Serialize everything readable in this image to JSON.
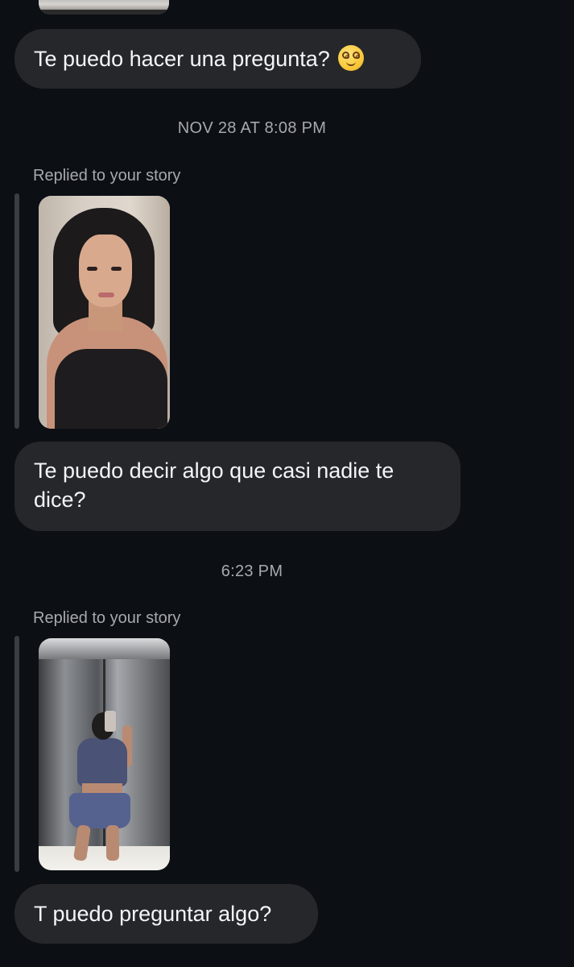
{
  "messages": [
    {
      "type": "text",
      "text": "Te puedo hacer una pregunta?",
      "emoji": "woozy-face-emoji"
    },
    {
      "type": "timestamp",
      "text": "NOV 28 AT 8:08 PM"
    },
    {
      "type": "story_reply_label",
      "text": "Replied to your story"
    },
    {
      "type": "story_thumbnail",
      "description": "story-photo-selfie"
    },
    {
      "type": "text",
      "text_line1": "Te puedo decir algo que casi nadie te",
      "text_line2": "dice?"
    },
    {
      "type": "timestamp",
      "text": "6:23 PM"
    },
    {
      "type": "story_reply_label",
      "text": "Replied to your story"
    },
    {
      "type": "story_thumbnail",
      "description": "story-photo-elevator-mirror"
    },
    {
      "type": "text",
      "text": "T puedo preguntar algo?"
    }
  ],
  "colors": {
    "background": "#0c0f14",
    "bubble": "#25272b",
    "meta_text": "#a6a9ae",
    "message_text": "#f4f5f7"
  }
}
